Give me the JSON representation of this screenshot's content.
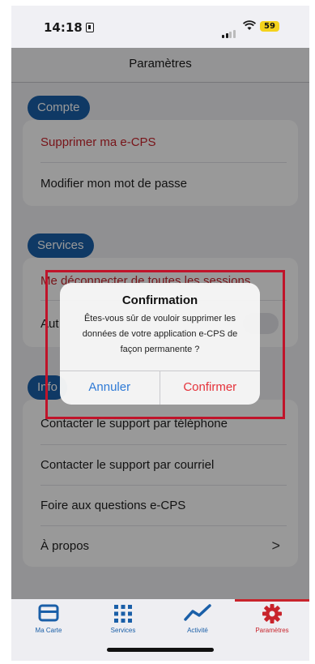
{
  "status_bar": {
    "time": "14:18",
    "battery": "59"
  },
  "header": {
    "title": "Paramètres"
  },
  "sections": {
    "compte": {
      "label": "Compte",
      "items": [
        "Supprimer ma e-CPS",
        "Modifier mon mot de passe"
      ]
    },
    "services": {
      "label": "Services",
      "items": [
        "Me déconnecter de toutes les sessions",
        "Aut"
      ]
    },
    "info": {
      "label": "Info",
      "items": [
        "Contacter le support par téléphone",
        "Contacter le support par courriel",
        "Foire aux questions e-CPS",
        "À propos"
      ]
    }
  },
  "dialog": {
    "title": "Confirmation",
    "message_lines": [
      "Êtes-vous sûr de vouloir supprimer les",
      "données de votre application e-CPS de",
      "façon permanente ?"
    ],
    "cancel_label": "Annuler",
    "confirm_label": "Confirmer"
  },
  "chevron": ">",
  "tabbar": {
    "tabs": [
      {
        "label": "Ma Carte",
        "icon": "card-icon"
      },
      {
        "label": "Services",
        "icon": "grid-icon"
      },
      {
        "label": "Activité",
        "icon": "activity-icon"
      },
      {
        "label": "Paramètres",
        "icon": "gear-icon",
        "active": true
      }
    ]
  },
  "colors": {
    "primary": "#1a5fa8",
    "danger": "#c8242c",
    "highlight": "#c0142a"
  }
}
